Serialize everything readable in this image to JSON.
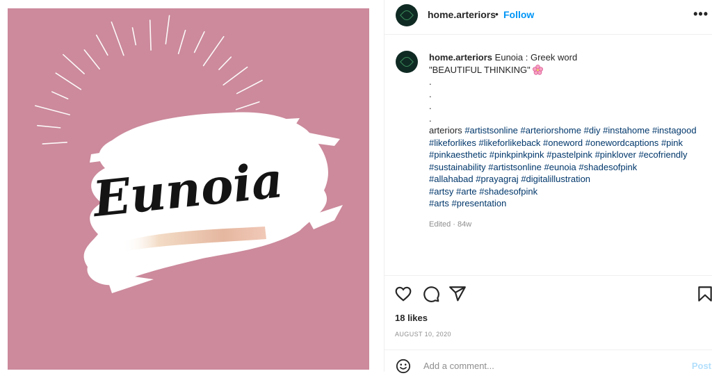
{
  "image": {
    "word": "Eunoia",
    "background": "#cc8a9c"
  },
  "header": {
    "username": "home.arteriors",
    "separator": "•",
    "follow_label": "Follow",
    "more_icon": "more-horizontal-icon"
  },
  "caption": {
    "username": "home.arteriors",
    "first_line": "Eunoia : Greek word",
    "second_line": "\"BEAUTIFUL THINKING\"",
    "emoji": "cherry-blossom-emoji",
    "dots": [
      ".",
      ".",
      ".",
      "."
    ],
    "lead_word": "arteriors",
    "hashtag_lines": [
      [
        "#artistsonline",
        "#arteriorshome",
        "#diy",
        "#instahome",
        "#instagood"
      ],
      [
        "#likeforlikes",
        "#likeforlikeback",
        "#oneword",
        "#onewordcaptions",
        "#pink"
      ],
      [
        "#pinkaesthetic",
        "#pinkpinkpink",
        "#pastelpink",
        "#pinklover",
        "#ecofriendly"
      ],
      [
        "#sustainability",
        "#artistsonline",
        "#eunoia",
        "#shadesofpink"
      ],
      [
        "#allahabad",
        "#prayagraj",
        "#digitalillustration"
      ],
      [
        "#artsy",
        "#arte",
        "#shadesofpink"
      ],
      [
        "#arts",
        "#presentation"
      ]
    ],
    "edited": "Edited · 84w"
  },
  "actions": {
    "like_icon": "heart-icon",
    "comment_icon": "comment-icon",
    "share_icon": "paper-plane-icon",
    "save_icon": "bookmark-icon"
  },
  "likes": "18 likes",
  "date": "AUGUST 10, 2020",
  "comment": {
    "placeholder": "Add a comment...",
    "post_label": "Post"
  },
  "colors": {
    "accent": "#0095f6",
    "hashtag": "#00376b",
    "muted": "#8e8e8e",
    "avatar": "#0f2a23"
  }
}
